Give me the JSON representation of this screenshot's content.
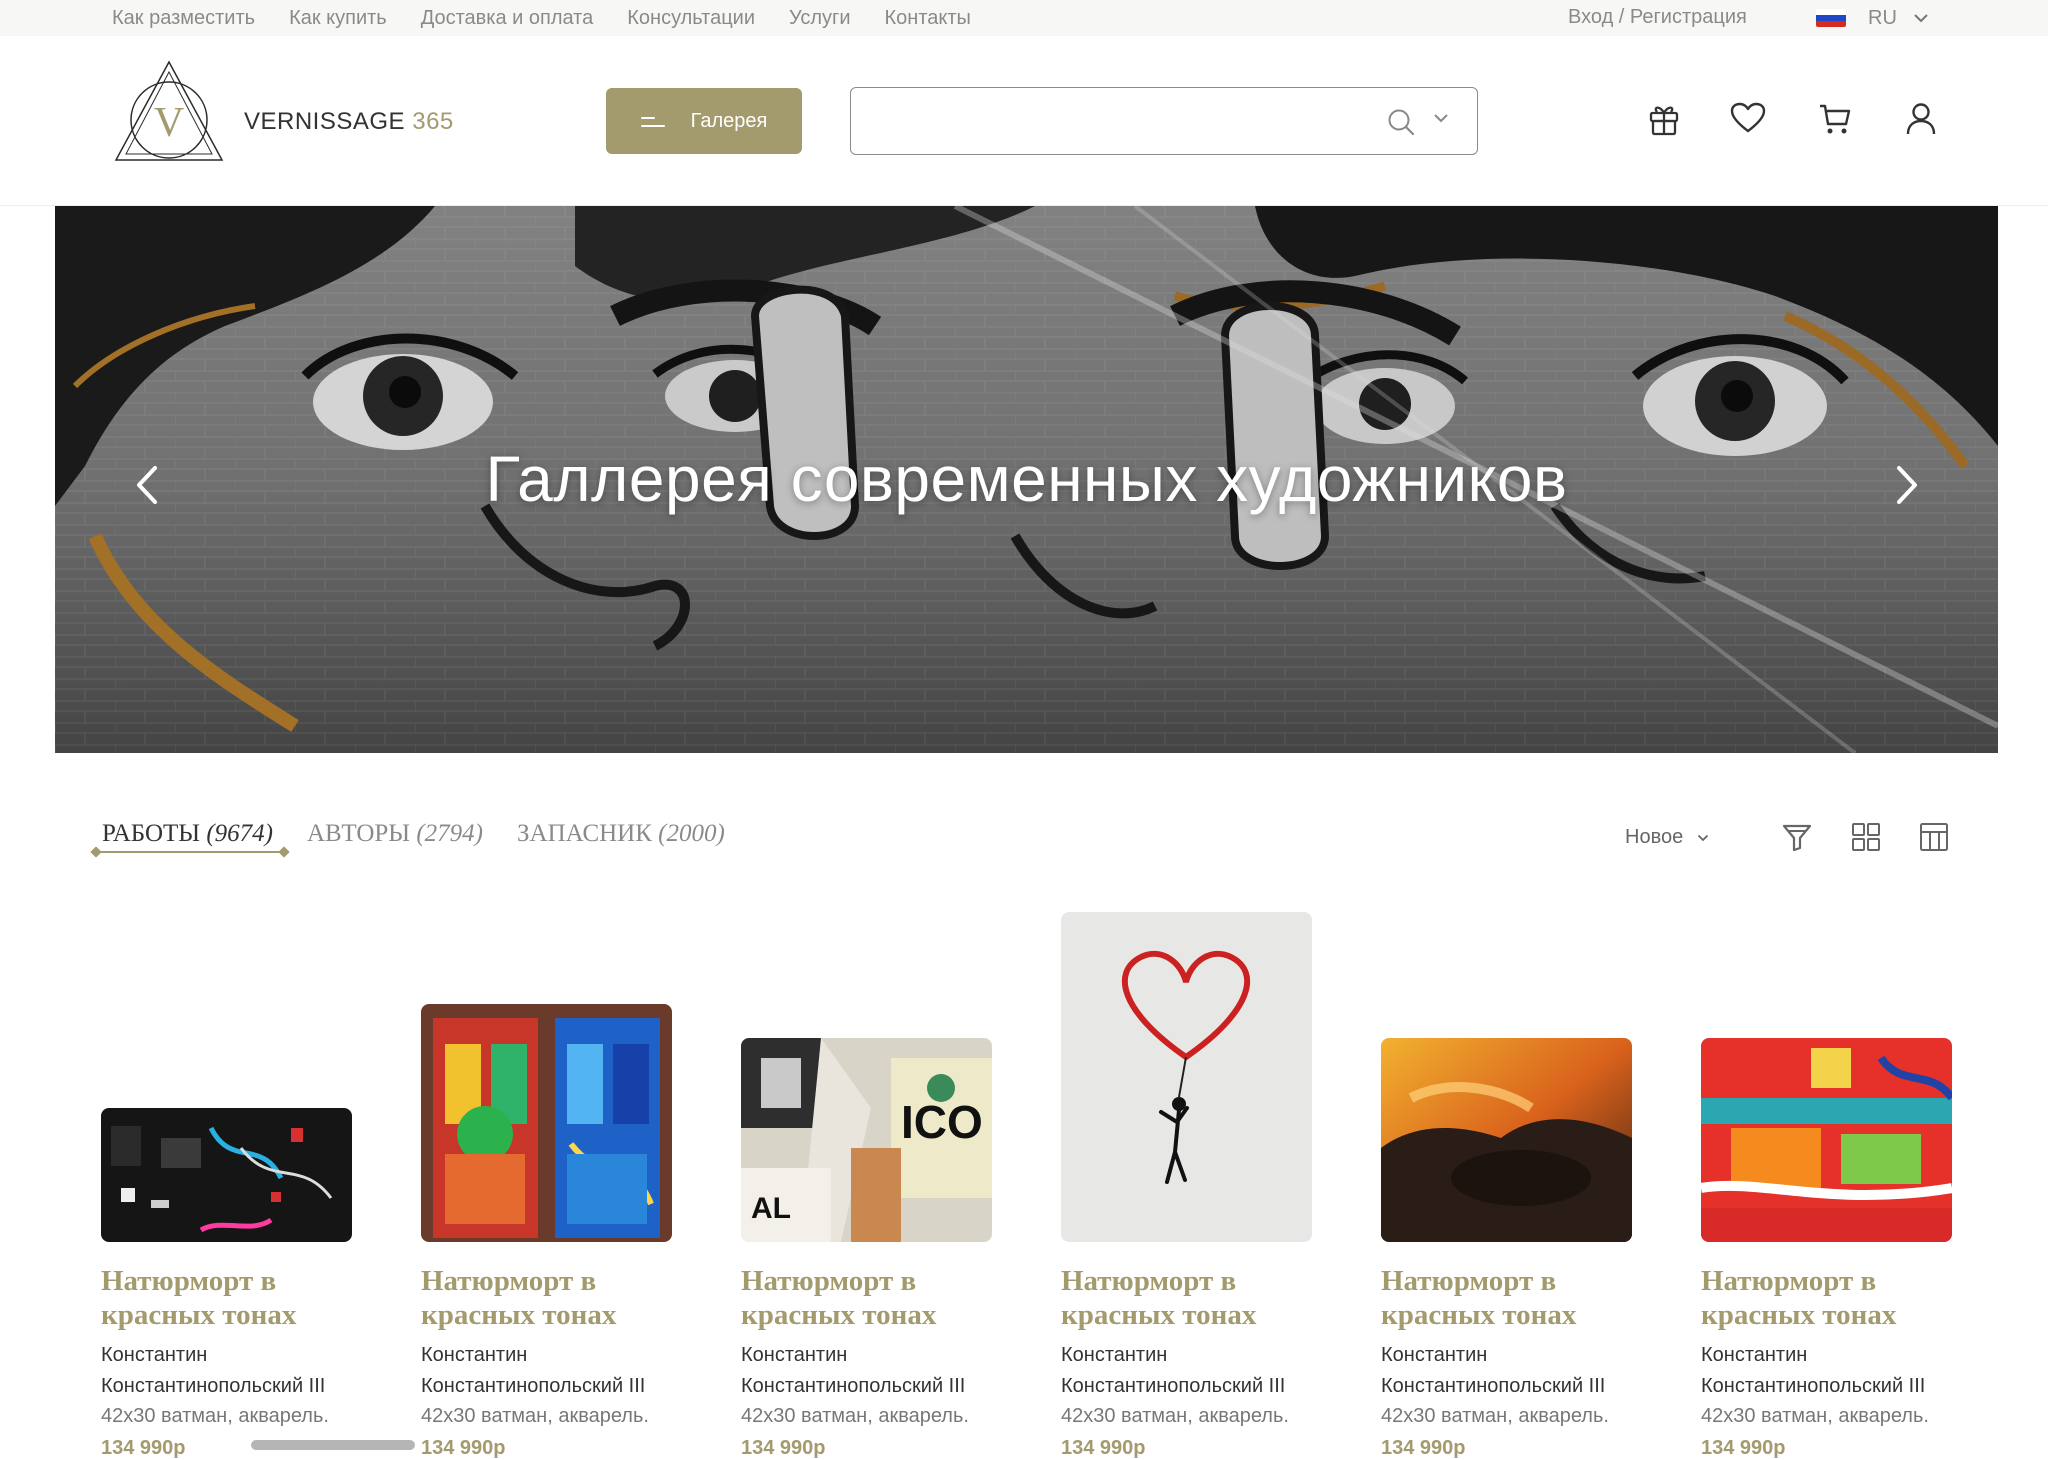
{
  "top_nav": {
    "links": [
      "Как разместить",
      "Как купить",
      "Доставка и оплата",
      "Консультации",
      "Услуги",
      "Контакты"
    ],
    "login": "Вход / Регистрация",
    "language": "RU"
  },
  "header": {
    "logo_letter": "V",
    "brand_name": "VERNISSAGE",
    "brand_number": "365",
    "gallery_button": "Галерея",
    "search_placeholder": "",
    "icons": [
      "gift-icon",
      "heart-icon",
      "cart-icon",
      "user-icon"
    ]
  },
  "hero": {
    "title": "Галлерея современных художников"
  },
  "tabs": [
    {
      "label": "РАБОТЫ",
      "count": "(9674)",
      "active": true
    },
    {
      "label": "АВТОРЫ",
      "count": "(2794)",
      "active": false
    },
    {
      "label": "ЗАПАСНИК",
      "count": "(2000)",
      "active": false
    }
  ],
  "sort": {
    "label": "Новое"
  },
  "products": [
    {
      "title": "Натюрморт в красных тонах",
      "author": "Константин Константинопольский III",
      "size": "42х30 ватман, акварель.",
      "price": "134 990р",
      "art": "graffiti-wall"
    },
    {
      "title": "Натюрморт в красных тонах",
      "author": "Константин Константинопольский III",
      "size": "42х30 ватман, акварель.",
      "price": "134 990р",
      "art": "painted-doors"
    },
    {
      "title": "Натюрморт в красных тонах",
      "author": "Константин Константинопольский III",
      "size": "42х30 ватман, акварель.",
      "price": "134 990р",
      "art": "torn-posters"
    },
    {
      "title": "Натюрморт в красных тонах",
      "author": "Константин Константинопольский III",
      "size": "42х30 ватман, акварель.",
      "price": "134 990р",
      "art": "heart-balloon"
    },
    {
      "title": "Натюрморт в красных тонах",
      "author": "Константин Константинопольский III",
      "size": "42х30 ватман, акварель.",
      "price": "134 990р",
      "art": "sunset-clouds"
    },
    {
      "title": "Натюрморт в красных тонах",
      "author": "Константин Константинопольский III",
      "size": "42х30 ватман, акварель.",
      "price": "134 990р",
      "art": "abstract-red"
    }
  ],
  "colors": {
    "accent": "#a39a6d",
    "muted_text": "#8a8a8a"
  }
}
